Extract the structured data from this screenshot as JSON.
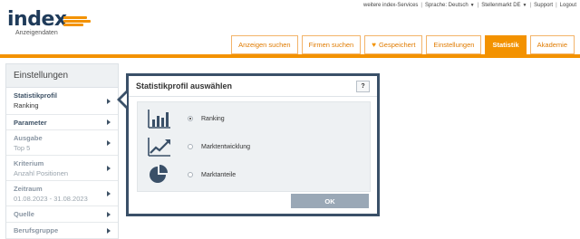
{
  "logo": {
    "brand": "index",
    "subtitle": "Anzeigendaten",
    "accent_color": "#f39200",
    "brand_color": "#1f3b5a"
  },
  "toplinks": {
    "services": "weitere index-Services",
    "language": "Sprache: Deutsch",
    "market": "Stellenmarkt DE",
    "support": "Support",
    "logout": "Logout"
  },
  "nav": {
    "tabs": [
      {
        "label": "Anzeigen suchen",
        "active": false
      },
      {
        "label": "Firmen suchen",
        "active": false
      },
      {
        "label": "Gespeichert",
        "active": false,
        "icon": "heart-icon"
      },
      {
        "label": "Einstellungen",
        "active": false
      },
      {
        "label": "Statistik",
        "active": true
      },
      {
        "label": "Akademie",
        "active": false
      }
    ]
  },
  "sidebar": {
    "title": "Einstellungen",
    "items": [
      {
        "title": "Statistikprofil",
        "value": "Ranking"
      },
      {
        "title": "Parameter",
        "value": ""
      },
      {
        "title": "Ausgabe",
        "value": "Top 5"
      },
      {
        "title": "Kriterium",
        "value": "Anzahl Positionen"
      },
      {
        "title": "Zeitraum",
        "value": "01.08.2023 - 31.08.2023"
      },
      {
        "title": "Quelle",
        "value": ""
      },
      {
        "title": "Berufsgruppe",
        "value": ""
      }
    ]
  },
  "modal": {
    "title": "Statistikprofil auswählen",
    "help_label": "?",
    "options": [
      {
        "label": "Ranking",
        "icon": "bar-chart-icon",
        "selected": true
      },
      {
        "label": "Marktentwicklung",
        "icon": "trend-chart-icon",
        "selected": false
      },
      {
        "label": "Marktanteile",
        "icon": "pie-chart-icon",
        "selected": false
      }
    ],
    "ok_label": "OK"
  }
}
